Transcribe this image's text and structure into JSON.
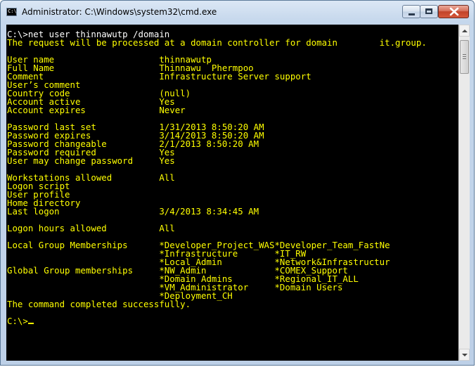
{
  "window": {
    "title": "Administrator: C:\\Windows\\system32\\cmd.exe",
    "icon_label": "C:\\",
    "icons": {
      "app": "console-app-icon",
      "minimize": "minimize-icon",
      "maximize": "maximize-icon",
      "close": "close-icon"
    }
  },
  "console": {
    "text_color": "#ffff00",
    "background_color": "#000000",
    "lines": [
      "C:\\>net user thinnawutp /domain",
      "The request will be processed at a domain controller for domain        it.group.",
      "",
      "User name                    thinnawutp",
      "Full Name                    Thinnawu  Phermpoo",
      "Comment                      Infrastructure Server support",
      "User’s comment",
      "Country code                 (null)",
      "Account active               Yes",
      "Account expires              Never",
      "",
      "Password last set            1/31/2013 8:50:20 AM",
      "Password expires             3/14/2013 8:50:20 AM",
      "Password changeable          2/1/2013 8:50:20 AM",
      "Password required            Yes",
      "User may change password     Yes",
      "",
      "Workstations allowed         All",
      "Logon script",
      "User profile",
      "Home directory",
      "Last logon                   3/4/2013 8:34:45 AM",
      "",
      "Logon hours allowed          All",
      "",
      "Local Group Memberships      *Developer_Project_WAS*Developer_Team_FastNe",
      "                             *Infrastructure       *IT_RW",
      "                             *Local_Admin          *Network&Infrastructur",
      "Global Group memberships     *NW_Admin             *COMEX_Support",
      "                             *Domain Admins        *Regional_IT_ALL",
      "                             *VM_Administrator     *Domain Users",
      "                             *Deployment_CH",
      "The command completed successfully.",
      "",
      "C:\\>"
    ]
  }
}
